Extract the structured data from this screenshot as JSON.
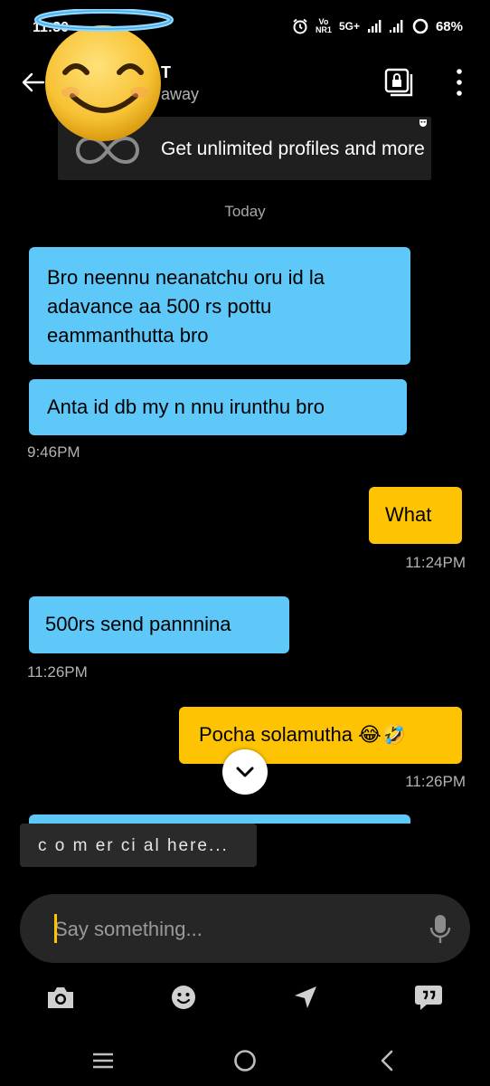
{
  "status_bar": {
    "time": "11:30",
    "network_top": "Vo",
    "network_bottom": "NR1",
    "network_type": "5G+",
    "battery": "68%"
  },
  "header": {
    "name": "T",
    "status": "away"
  },
  "promo": {
    "text": "Get unlimited profiles and more"
  },
  "day_label": "Today",
  "messages": [
    {
      "direction": "in",
      "text": "Bro neennu neanatchu oru id la adavance aa 500 rs pottu eammanthutta bro"
    },
    {
      "direction": "in",
      "text": "Anta id db my n  nnu irunthu bro",
      "time": "9:46PM"
    },
    {
      "direction": "out",
      "text": "What",
      "time": "11:24PM"
    },
    {
      "direction": "in",
      "text": "500rs send pannnina",
      "time": "11:26PM"
    },
    {
      "direction": "out",
      "text": "Pocha solamutha 😂🤣",
      "time": "11:26PM"
    }
  ],
  "overlay_text": "c o m er ci al  here...",
  "compose": {
    "placeholder": "Say something..."
  },
  "icons": {
    "back": "arrow-left-icon",
    "lock": "locked-album-icon",
    "more": "more-vertical-icon",
    "scroll": "chevron-down-icon",
    "mic": "microphone-icon",
    "camera": "camera-icon",
    "emoji": "emoji-icon",
    "location": "location-arrow-icon",
    "phrases": "saved-phrases-icon"
  },
  "colors": {
    "incoming": "#5ec8f8",
    "outgoing": "#fec403",
    "background": "#000000"
  }
}
